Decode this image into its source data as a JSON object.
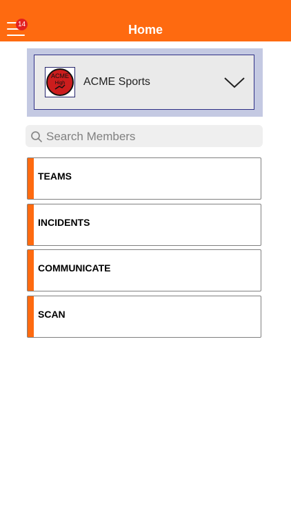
{
  "header": {
    "title": "Home",
    "notification_count": "14",
    "background_color": "#fe6a10"
  },
  "organization": {
    "name": "ACME Sports",
    "logo_text_top": "ACME",
    "logo_text_bottom": "High"
  },
  "search": {
    "placeholder": "Search Members"
  },
  "menu": {
    "items": [
      {
        "label": "TEAMS"
      },
      {
        "label": "INCIDENTS"
      },
      {
        "label": "COMMUNICATE"
      },
      {
        "label": "SCAN"
      }
    ],
    "accent_color": "#fe6a10"
  }
}
